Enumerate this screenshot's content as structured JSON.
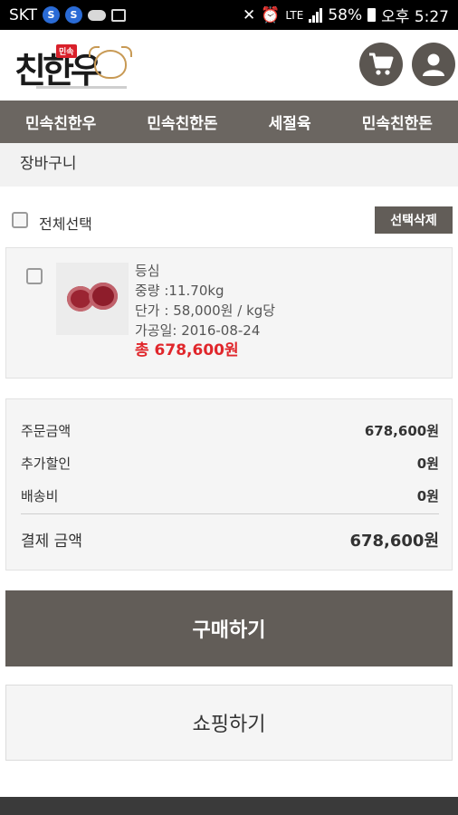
{
  "status_bar": {
    "carrier": "SKT",
    "lte": "LTE",
    "battery": "58%",
    "time": "오후 5:27"
  },
  "header": {
    "logo_text": "친한우",
    "logo_badge": "민속",
    "cart_icon": "cart-icon",
    "user_icon": "user-icon"
  },
  "nav": {
    "items": [
      {
        "label": "민속친한우"
      },
      {
        "label": "민속친한돈"
      },
      {
        "label": "세절육"
      },
      {
        "label": "민속친한돈"
      }
    ]
  },
  "page": {
    "title": "장바구니"
  },
  "selection": {
    "select_all_label": "전체선택",
    "delete_selected_label": "선택삭제"
  },
  "cart_item": {
    "name": "등심",
    "weight": "중량 :11.70kg",
    "unit_price": "단가 : 58,000원 / kg당",
    "processed_date": "가공일: 2016-08-24",
    "total": "총 678,600원"
  },
  "summary": {
    "order_amount_label": "주문금액",
    "order_amount_value": "678,600원",
    "extra_discount_label": "추가할인",
    "extra_discount_value": "0원",
    "shipping_label": "배송비",
    "shipping_value": "0원",
    "payment_label": "결제 금액",
    "payment_value": "678,600원"
  },
  "actions": {
    "buy_label": "구매하기",
    "shop_label": "쇼핑하기"
  },
  "colors": {
    "nav_bg": "#6b6661",
    "button_dark": "#625d58",
    "price_red": "#e0262b"
  }
}
